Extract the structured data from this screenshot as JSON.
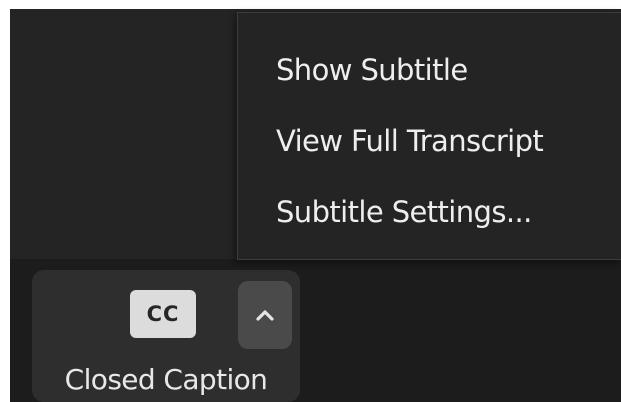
{
  "colors": {
    "meeting_background": "#242424",
    "toolbar_background": "#1c1c1c",
    "button_background": "#2e2e2e",
    "caret_background": "#4a4a4a",
    "cc_badge_background": "#dcdcdc",
    "menu_background": "#242424",
    "text": "#eeeeee"
  },
  "subtitle_menu": {
    "items": [
      {
        "label": "Show Subtitle"
      },
      {
        "label": "View Full Transcript"
      },
      {
        "label": "Subtitle Settings..."
      }
    ]
  },
  "toolbar": {
    "closed_caption": {
      "icon_text": "CC",
      "icon": "closed-caption-icon",
      "label": "Closed Caption",
      "options_icon": "chevron-up-icon"
    }
  }
}
